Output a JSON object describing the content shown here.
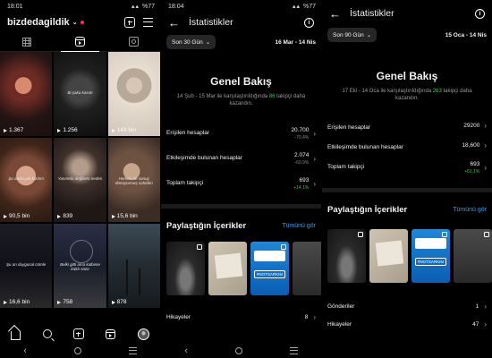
{
  "profile": {
    "status_time": "18:01",
    "status_battery": "%77",
    "username": "bizdedagildik",
    "reels": [
      {
        "count": "1.367",
        "caption": ""
      },
      {
        "count": "1.256",
        "caption": "Bi şaka kasım"
      },
      {
        "count": "143 bin",
        "caption": ""
      },
      {
        "count": "90,5 bin",
        "caption": "Şu anda çok kızdım"
      },
      {
        "count": "839",
        "caption": "Yanımda değilsen neden"
      },
      {
        "count": "15,6 bin",
        "caption": "Hemen de sonuç dönüyormuş sahiden"
      },
      {
        "count": "16,6 bin",
        "caption": "Şu an duygusal cümle"
      },
      {
        "count": "758",
        "caption": "Belki gitti ama kalbime kaldı sözü"
      },
      {
        "count": "878",
        "caption": ""
      }
    ]
  },
  "stats_30": {
    "status_time": "18:04",
    "status_battery": "%77",
    "title": "İstatistikler",
    "range_label": "Son 30 Gün",
    "date_range": "16 Mar - 14 Nis",
    "overview_title": "Genel Bakış",
    "overview_sub_pre": "14 Şub - 15 Mar ile karşılaştırıldığında ",
    "overview_sub_num": "86",
    "overview_sub_post": " takipçi daha kazandın.",
    "rows": [
      {
        "label": "Erişilen hesaplar",
        "value": "20.700",
        "change": "-70,4%",
        "positive": false
      },
      {
        "label": "Etkileşimde bulunan hesaplar",
        "value": "2.074",
        "change": "-60,9%",
        "positive": false
      },
      {
        "label": "Toplam takipçi",
        "value": "693",
        "change": "+14,1%",
        "positive": true
      }
    ],
    "section_title": "Paylaştığın İçerikler",
    "section_link": "Tümünü gör",
    "thumb_tag": "#NOTSARKIM",
    "list": [
      {
        "label": "Hikayeler",
        "value": "8"
      }
    ]
  },
  "stats_90": {
    "title": "İstatistikler",
    "range_label": "Son 90 Gün",
    "date_range": "15 Oca - 14 Nis",
    "overview_title": "Genel Bakış",
    "overview_sub_pre": "17 Eki - 14 Oca ile karşılaştırıldığında ",
    "overview_sub_num": "263",
    "overview_sub_post": " takipçi daha kazandın.",
    "rows": [
      {
        "label": "Erişilen hesaplar",
        "value": "29200",
        "change": "",
        "positive": false
      },
      {
        "label": "Etkileşimde bulunan hesaplar",
        "value": "18,600",
        "change": "",
        "positive": false
      },
      {
        "label": "Toplam takipçi",
        "value": "693",
        "change": "+61,1%",
        "positive": true
      }
    ],
    "section_title": "Paylaştığın İçerikler",
    "section_link": "Tümünü gör",
    "thumb_tag": "#NOTSARKIM",
    "list": [
      {
        "label": "Gönderiler",
        "value": "1"
      },
      {
        "label": "Hikayeler",
        "value": "47"
      }
    ]
  },
  "colors": {
    "accent_link": "#3a9bf0",
    "positive": "#3ec25a",
    "notification_dot": "#ff2d55",
    "background": "#000000"
  }
}
